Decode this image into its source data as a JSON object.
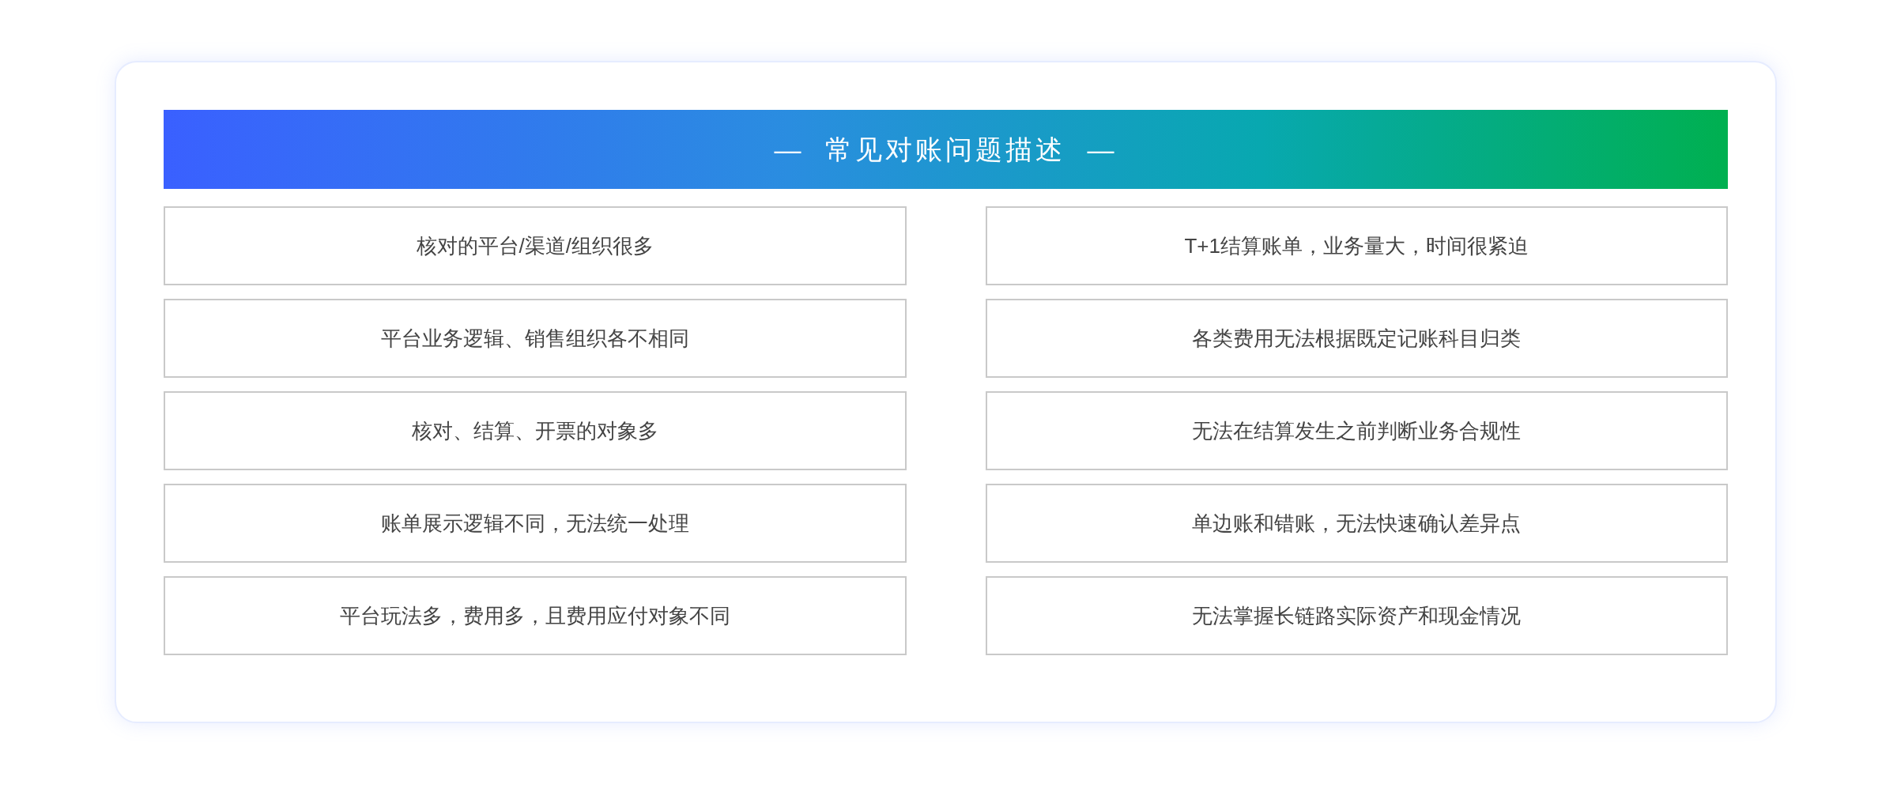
{
  "title": "—  常见对账问题描述  —",
  "left_items": [
    "核对的平台/渠道/组织很多",
    "平台业务逻辑、销售组织各不相同",
    "核对、结算、开票的对象多",
    "账单展示逻辑不同，无法统一处理",
    "平台玩法多，费用多，且费用应付对象不同"
  ],
  "right_items": [
    "T+1结算账单，业务量大，时间很紧迫",
    "各类费用无法根据既定记账科目归类",
    "无法在结算发生之前判断业务合规性",
    "单边账和错账，无法快速确认差异点",
    "无法掌握长链路实际资产和现金情况"
  ]
}
